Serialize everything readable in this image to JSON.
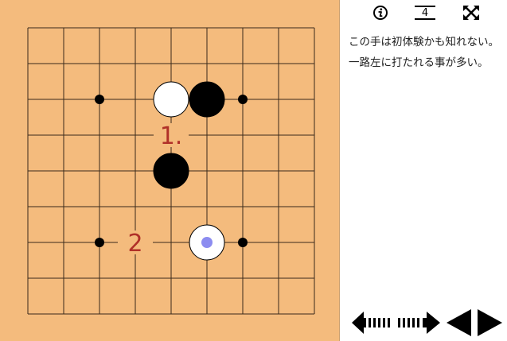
{
  "board": {
    "size": 9,
    "star_points": [
      [
        2,
        2
      ],
      [
        6,
        2
      ],
      [
        2,
        6
      ],
      [
        6,
        6
      ]
    ],
    "stones": [
      {
        "col": 4,
        "row": 2,
        "color": "white"
      },
      {
        "col": 5,
        "row": 2,
        "color": "black"
      },
      {
        "col": 4,
        "row": 4,
        "color": "black"
      },
      {
        "col": 5,
        "row": 6,
        "color": "white",
        "current_move": true
      }
    ],
    "markers": [
      {
        "col": 4,
        "row": 3,
        "text": "1."
      },
      {
        "col": 3,
        "row": 6,
        "text": "2"
      }
    ],
    "colors": {
      "background": "#f4bb7d",
      "grid": "#3a2a1a",
      "marker_text": "#b03028",
      "current_move_dot": "#8c8cf0"
    }
  },
  "toolbar": {
    "info_icon": "info-icon",
    "move_number": "4",
    "fullscreen_icon": "fullscreen-icon"
  },
  "comment": "この手は初体験かも知れない。一路左に打たれる事が多い。",
  "navigation": {
    "prev_ten_icon": "fast-backward-arrow-icon",
    "next_ten_icon": "fast-forward-arrow-icon",
    "prev_icon": "triangle-left-icon",
    "next_icon": "triangle-right-icon"
  }
}
